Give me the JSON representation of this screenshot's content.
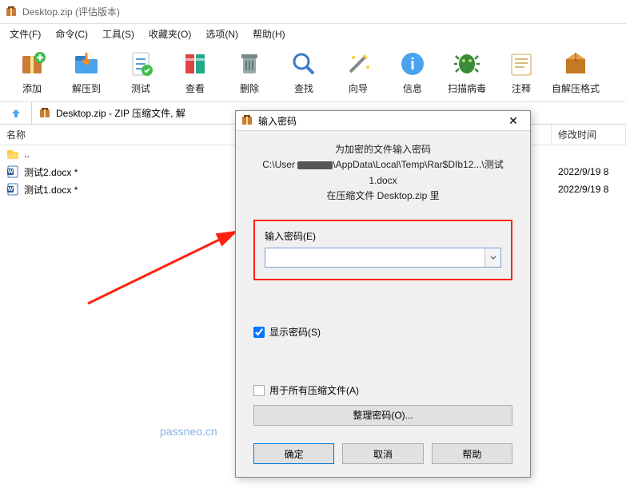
{
  "window": {
    "title": "Desktop.zip (评估版本)"
  },
  "menus": [
    "文件(F)",
    "命令(C)",
    "工具(S)",
    "收藏夹(O)",
    "选项(N)",
    "帮助(H)"
  ],
  "tools": [
    {
      "name": "add",
      "label": "添加"
    },
    {
      "name": "extract",
      "label": "解压到"
    },
    {
      "name": "test",
      "label": "测试"
    },
    {
      "name": "view",
      "label": "查看"
    },
    {
      "name": "delete",
      "label": "删除"
    },
    {
      "name": "find",
      "label": "查找"
    },
    {
      "name": "wizard",
      "label": "向导"
    },
    {
      "name": "info",
      "label": "信息"
    },
    {
      "name": "scan",
      "label": "扫描病毒"
    },
    {
      "name": "comment",
      "label": "注释"
    },
    {
      "name": "sfx",
      "label": "自解压格式"
    }
  ],
  "path": {
    "crumb": "Desktop.zip - ZIP 压缩文件, 解"
  },
  "columns": {
    "name": "名称",
    "mod": "修改时间"
  },
  "files": [
    {
      "icon": "folder-up",
      "name": "..",
      "mod": ""
    },
    {
      "icon": "docx",
      "name": "测试2.docx *",
      "mod": "2022/9/19 8"
    },
    {
      "icon": "docx",
      "name": "测试1.docx *",
      "mod": "2022/9/19 8"
    }
  ],
  "dialog": {
    "title": "输入密码",
    "line1": "为加密的文件输入密码",
    "line2a": "C:\\User",
    "line2b": "\\AppData\\Local\\Temp\\Rar$DIb12...\\测试1.docx",
    "line3": "在压缩文件 Desktop.zip 里",
    "pw_label": "输入密码(E)",
    "pw_value": "",
    "show_pw": "显示密码(S)",
    "all_archives": "用于所有压缩文件(A)",
    "organize": "整理密码(O)...",
    "ok": "确定",
    "cancel": "取消",
    "help": "帮助"
  },
  "watermark": "passneo.cn"
}
